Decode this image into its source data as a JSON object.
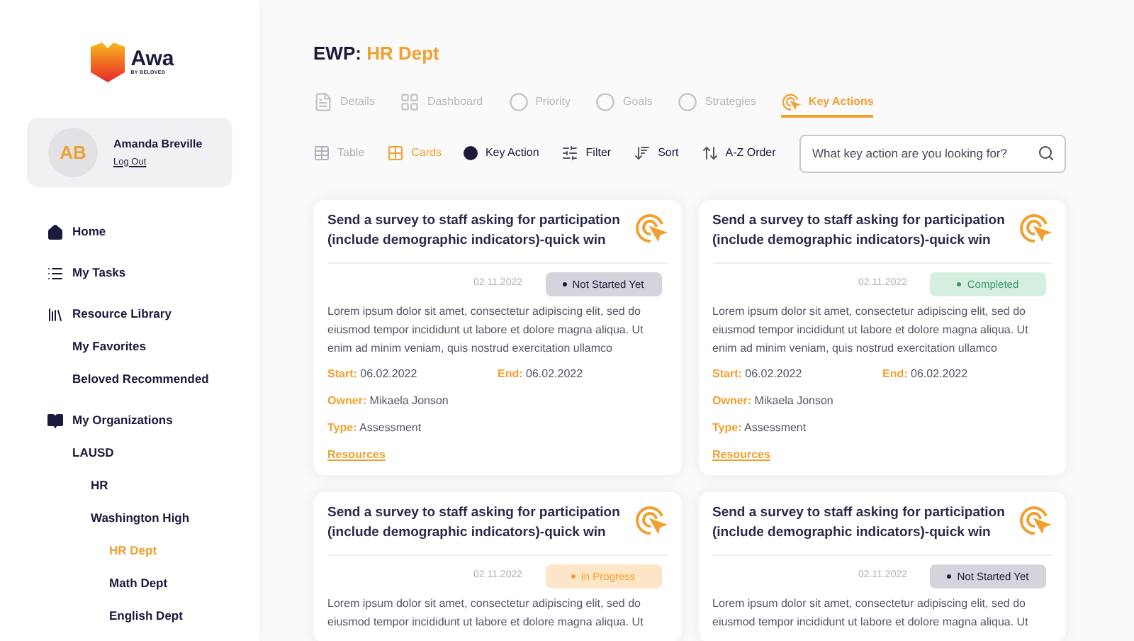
{
  "logo": {
    "name": "Awa",
    "tagline": "BY BELOVED"
  },
  "user": {
    "initials": "AB",
    "name": "Amanda Breville",
    "logout": "Log Out"
  },
  "sidebar": {
    "items": [
      {
        "label": "Home",
        "kind": "home",
        "selected": false
      },
      {
        "label": "My Tasks",
        "kind": "tasks",
        "selected": false
      },
      {
        "label": "Resource Library",
        "kind": "library",
        "selected": false,
        "children": [
          {
            "label": "My Favorites",
            "selected": false
          },
          {
            "label": "Beloved Recommended",
            "selected": false
          }
        ]
      },
      {
        "label": "My Organizations",
        "kind": "book",
        "selected": false,
        "children": [
          {
            "label": "LAUSD",
            "selected": false,
            "children": [
              {
                "label": "HR",
                "selected": false
              },
              {
                "label": "Washington High",
                "selected": false,
                "children": [
                  {
                    "label": "HR Dept",
                    "selected": true
                  },
                  {
                    "label": "Math Dept",
                    "selected": false
                  },
                  {
                    "label": "English Dept",
                    "selected": false
                  }
                ]
              }
            ]
          }
        ]
      }
    ]
  },
  "page_title": {
    "prefix": "EWP:",
    "name": "HR Dept"
  },
  "tabs": [
    {
      "label": "Details",
      "kind": "doc",
      "selected": false
    },
    {
      "label": "Dashboard",
      "kind": "grid",
      "selected": false
    },
    {
      "label": "Priority",
      "kind": "circle",
      "selected": false
    },
    {
      "label": "Goals",
      "kind": "circle",
      "selected": false
    },
    {
      "label": "Strategies",
      "kind": "circle",
      "selected": false
    },
    {
      "label": "Key Actions",
      "kind": "target",
      "selected": true
    }
  ],
  "toolbar": [
    {
      "label": "Table",
      "kind": "table",
      "selected": false
    },
    {
      "label": "Cards",
      "kind": "cards",
      "selected": true
    },
    {
      "label": "Key Action",
      "kind": "dot",
      "selected": false
    },
    {
      "label": "Filter",
      "kind": "filter",
      "selected": false
    },
    {
      "label": "Sort",
      "kind": "sort",
      "selected": false
    },
    {
      "label": "A-Z Order",
      "kind": "az",
      "selected": false
    }
  ],
  "search": {
    "placeholder": "What key action are you looking for?"
  },
  "cards": [
    {
      "title": "Send a survey to staff asking for participation (include demographic indicators)-quick win",
      "date": "02.11.2022",
      "status": "Not Started Yet",
      "kind": "not_started",
      "description": "Lorem ipsum dolor sit amet, consectetur adipiscing elit, sed do eiusmod tempor incididunt ut labore et dolore magna aliqua. Ut enim ad minim veniam, quis nostrud exercitation ullamco",
      "start_label": "Start:",
      "start": "06.02.2022",
      "end_label": "End:",
      "end": "06.02.2022",
      "owner_label": "Owner:",
      "owner": "Mikaela Jonson",
      "type_label": "Type:",
      "type": "Assessment",
      "link": "Resources"
    },
    {
      "title": "Send a survey to staff asking for participation (include demographic indicators)-quick win",
      "date": "02.11.2022",
      "status": "Completed",
      "kind": "completed",
      "description": "Lorem ipsum dolor sit amet, consectetur adipiscing elit, sed do eiusmod tempor incididunt ut labore et dolore magna aliqua. Ut enim ad minim veniam, quis nostrud exercitation ullamco",
      "start_label": "Start:",
      "start": "06.02.2022",
      "end_label": "End:",
      "end": "06.02.2022",
      "owner_label": "Owner:",
      "owner": "Mikaela Jonson",
      "type_label": "Type:",
      "type": "Assessment",
      "link": "Resources"
    },
    {
      "title": "Send a survey to staff asking for participation (include demographic indicators)-quick win",
      "date": "02.11.2022",
      "status": "In Progress",
      "kind": "in_progress",
      "description": "Lorem ipsum dolor sit amet, consectetur adipiscing elit, sed do eiusmod tempor incididunt ut labore et dolore magna aliqua. Ut"
    },
    {
      "title": "Send a survey to staff asking for participation (include demographic indicators)-quick win",
      "date": "02.11.2022",
      "status": "Not Started Yet",
      "kind": "not_started",
      "description": "Lorem ipsum dolor sit amet, consectetur adipiscing elit, sed do eiusmod tempor incididunt ut labore et dolore magna aliqua. Ut"
    }
  ]
}
